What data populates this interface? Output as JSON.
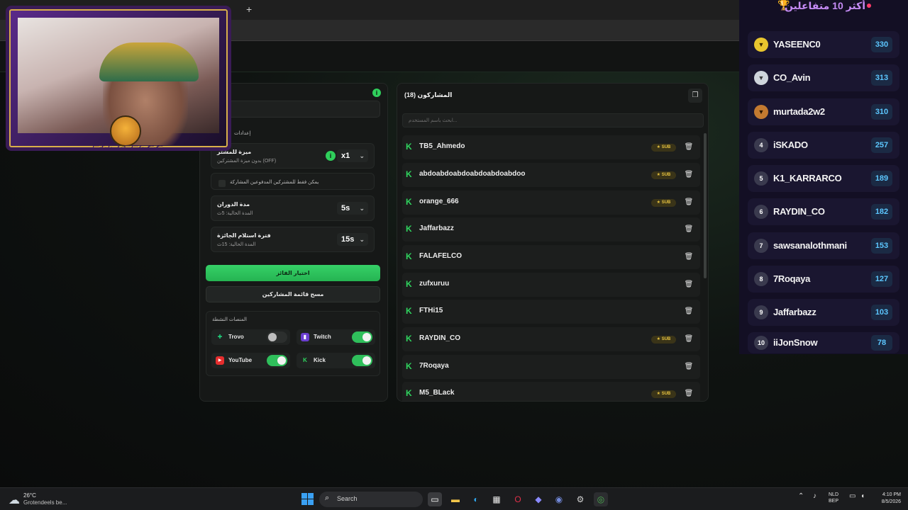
{
  "browser": {
    "new_tab": "+"
  },
  "webcam": {
    "brand": "FALAFELCO"
  },
  "settings": {
    "section_prefix": "إعدادات",
    "feature": {
      "title": "ميزة للمشتر",
      "status": "بدون ميزة المشتركين (OFF)",
      "multiplier": "x1"
    },
    "subs_only": "يمكن فقط للمشتركين المدفوعين المشاركة",
    "rotation": {
      "title": "مدة الدوران",
      "current": "المدة الحالية: 5ث",
      "value": "5s"
    },
    "claim": {
      "title": "فترة استلام الجائزة",
      "current": "المدة الحالية: 15ث",
      "value": "15s"
    },
    "pick_winner": "اختيار الفائز",
    "clear_list": "مسح قائمة المشاركين",
    "platforms_title": "المنصات النشطة",
    "platforms": [
      {
        "name": "Trovo",
        "on": false
      },
      {
        "name": "Twitch",
        "on": true
      },
      {
        "name": "YouTube",
        "on": true
      },
      {
        "name": "Kick",
        "on": true
      }
    ]
  },
  "participants": {
    "title": "المشاركون (18)",
    "search_placeholder": "ابحث باسم المستخدم...",
    "sub_label": "SUB",
    "rows": [
      {
        "name": "TB5_Ahmedo",
        "sub": true
      },
      {
        "name": "abdoabdoabdoabdoabdoabdoo",
        "sub": true
      },
      {
        "name": "orange_666",
        "sub": true
      },
      {
        "name": "Jaffarbazz",
        "sub": false
      },
      {
        "name": "FALAFELCO",
        "sub": false
      },
      {
        "name": "zufxuruu",
        "sub": false
      },
      {
        "name": "FTHi15",
        "sub": false
      },
      {
        "name": "RAYDIN_CO",
        "sub": true
      },
      {
        "name": "7Roqaya",
        "sub": false
      },
      {
        "name": "M5_BLack",
        "sub": true
      }
    ]
  },
  "leaderboard": {
    "title": "أكثر 10 متفاعلين",
    "rows": [
      {
        "rank": "",
        "name": "YASEENC0",
        "score": "330"
      },
      {
        "rank": "",
        "name": "CO_Avin",
        "score": "313"
      },
      {
        "rank": "",
        "name": "murtada2w2",
        "score": "310"
      },
      {
        "rank": "4",
        "name": "iSKADO",
        "score": "257"
      },
      {
        "rank": "5",
        "name": "K1_KARRARCO",
        "score": "189"
      },
      {
        "rank": "6",
        "name": "RAYDIN_CO",
        "score": "182"
      },
      {
        "rank": "7",
        "name": "sawsanalothmani",
        "score": "153"
      },
      {
        "rank": "8",
        "name": "7Roqaya",
        "score": "127"
      },
      {
        "rank": "9",
        "name": "Jaffarbazz",
        "score": "103"
      },
      {
        "rank": "10",
        "name": "iiJonSnow",
        "score": "78"
      }
    ]
  },
  "taskbar": {
    "temp": "26°C",
    "weather": "Grotendeels be...",
    "search": "Search",
    "lang1": "NLD",
    "lang2": "BEP",
    "time": "4:10 PM",
    "date": "8/5/2026"
  },
  "colors": {
    "accent_green": "#2fbf5b",
    "leaderboard_bg": "#130f24",
    "score_blue": "#5cc7ff"
  }
}
